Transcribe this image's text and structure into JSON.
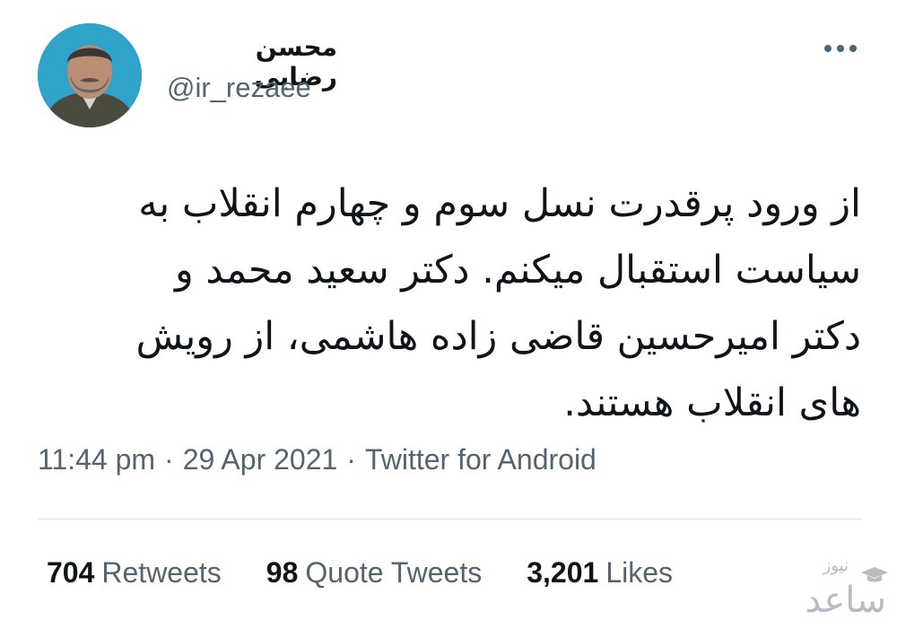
{
  "user": {
    "display_name": "محسن رضایی",
    "handle": "@ir_rezaee"
  },
  "icons": {
    "more": "more-options-icon",
    "avatar": "profile-photo"
  },
  "tweet": {
    "text": "از ورود پرقدرت نسل سوم و چهارم انقلاب به\nسیاست استقبال میکنم. دکتر سعید محمد و\nدکتر امیرحسین قاضی زاده هاشمی، از رویش\nهای انقلاب هستند."
  },
  "meta": {
    "time": "11:44 pm",
    "date": "29 Apr 2021",
    "separator": "·",
    "source": "Twitter for Android"
  },
  "stats": [
    {
      "count": "704",
      "label": "Retweets"
    },
    {
      "count": "98",
      "label": "Quote Tweets"
    },
    {
      "count": "3,201",
      "label": "Likes"
    }
  ],
  "watermark": {
    "small": "نیوز",
    "large": "ساعد"
  },
  "colors": {
    "text": "#0f1419",
    "secondary": "#536471",
    "divider": "#d9dfe3",
    "avatar_bg": "#2fa3c9"
  }
}
